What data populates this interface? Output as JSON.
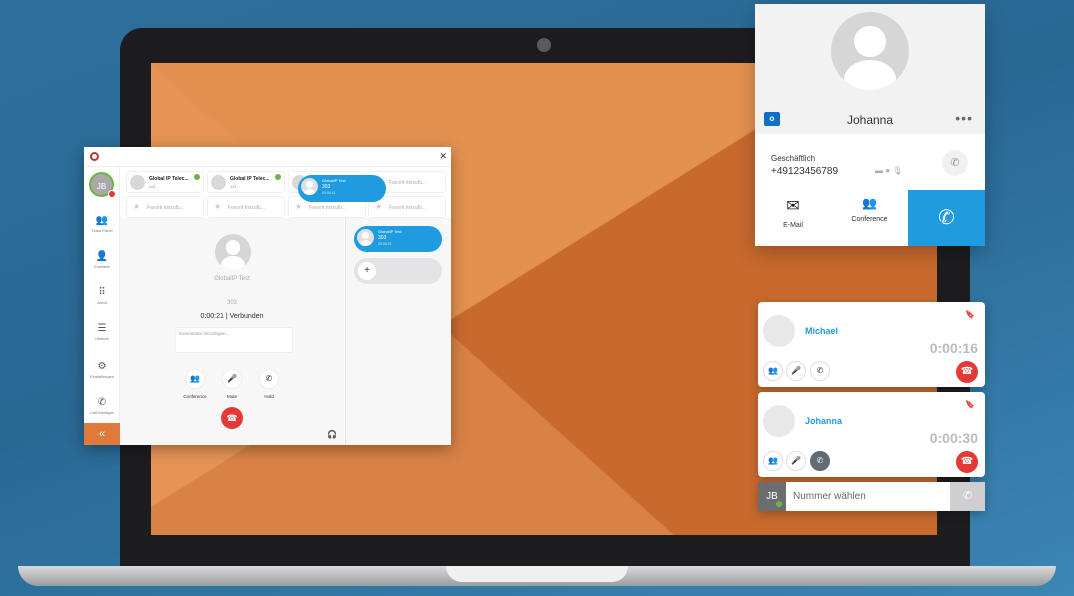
{
  "app": {
    "sidebar": {
      "avatar_initials": "JB",
      "items": [
        {
          "icon": "team-panel-icon",
          "glyph": "👥",
          "label": "Team Panel"
        },
        {
          "icon": "contacts-icon",
          "glyph": "👤",
          "label": "Kontakte"
        },
        {
          "icon": "dialpad-icon",
          "glyph": "⠿",
          "label": "Anruf"
        },
        {
          "icon": "history-icon",
          "glyph": "☰",
          "label": "Historie"
        },
        {
          "icon": "settings-icon",
          "glyph": "⚙",
          "label": "Einstellungen"
        },
        {
          "icon": "call-manager-icon",
          "glyph": "✆",
          "label": "Call-Manager"
        }
      ],
      "collapse_glyph": "«"
    },
    "favorites": [
      {
        "name": "Global IP Telec...",
        "number": "121"
      },
      {
        "name": "Global IP Telec...",
        "number": "121"
      },
      {
        "name": "Favorit hinzufü..."
      },
      {
        "name": "Favorit hinzufü..."
      },
      {
        "name": "Favorit hinzufü..."
      },
      {
        "name": "Favorit hinzufü..."
      },
      {
        "name": "Favorit hinzufü..."
      }
    ],
    "drag_pill": {
      "title": "GlobalIP Test",
      "number": "303",
      "time": "00:00:11"
    },
    "call": {
      "name": "GlobalIP Test",
      "number": "303",
      "status": "0:00:21 | Verbunden",
      "comment_placeholder": "Kommentar hinzufügen...",
      "buttons": [
        "Conference",
        "Mute",
        "Hold"
      ]
    },
    "active_pill": {
      "title": "GlobalIP Test",
      "number": "303",
      "time": "00:00:21"
    },
    "add_glyph": "+"
  },
  "contact_card": {
    "name": "Johanna",
    "phone_label": "Geschäftlich",
    "phone": "+49123456789",
    "actions": {
      "email": "E-Mail",
      "conference": "Conference"
    }
  },
  "calls": [
    {
      "name": "Michael",
      "time": "0:00:16"
    },
    {
      "name": "Johanna",
      "time": "0:00:30"
    }
  ],
  "dial": {
    "initials": "JB",
    "placeholder": "Nummer wählen"
  }
}
